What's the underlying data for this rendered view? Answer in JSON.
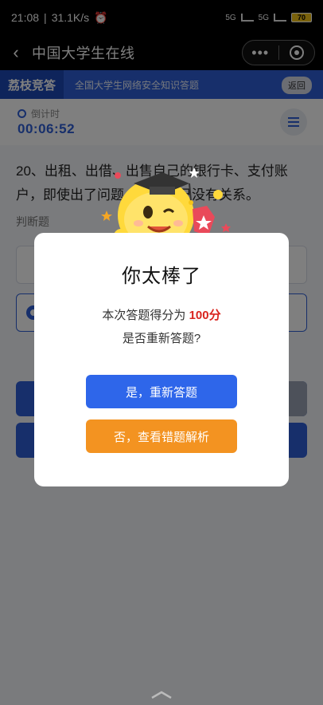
{
  "status_bar": {
    "time": "21:08",
    "speed": "31.1K/s",
    "network": "5G",
    "battery": "70"
  },
  "nav": {
    "back_icon": "chevron-left-icon",
    "title": "中国大学生在线",
    "more_icon": "more-dots-icon",
    "target_icon": "target-icon"
  },
  "sub_header": {
    "brand": "荔枝竞答",
    "title": "全国大学生网络安全知识答题",
    "back_label": "返回"
  },
  "timer": {
    "label": "倒计时",
    "value": "00:06:52"
  },
  "question": {
    "text": "20、出租、出借、出售自己的银行卡、支付账户，即使出了问题，也和自己没有关系。",
    "type": "判断题"
  },
  "modal": {
    "title": "你太棒了",
    "score_prefix": "本次答题得分为 ",
    "score_value": "100分",
    "ask": "是否重新答题?",
    "retry_label": "是，重新答题",
    "review_label": "否，查看错题解析"
  },
  "colors": {
    "primary": "#2e5fd6",
    "retry_button": "#2e66ea",
    "review_button": "#f39321",
    "score": "#d9241e"
  }
}
